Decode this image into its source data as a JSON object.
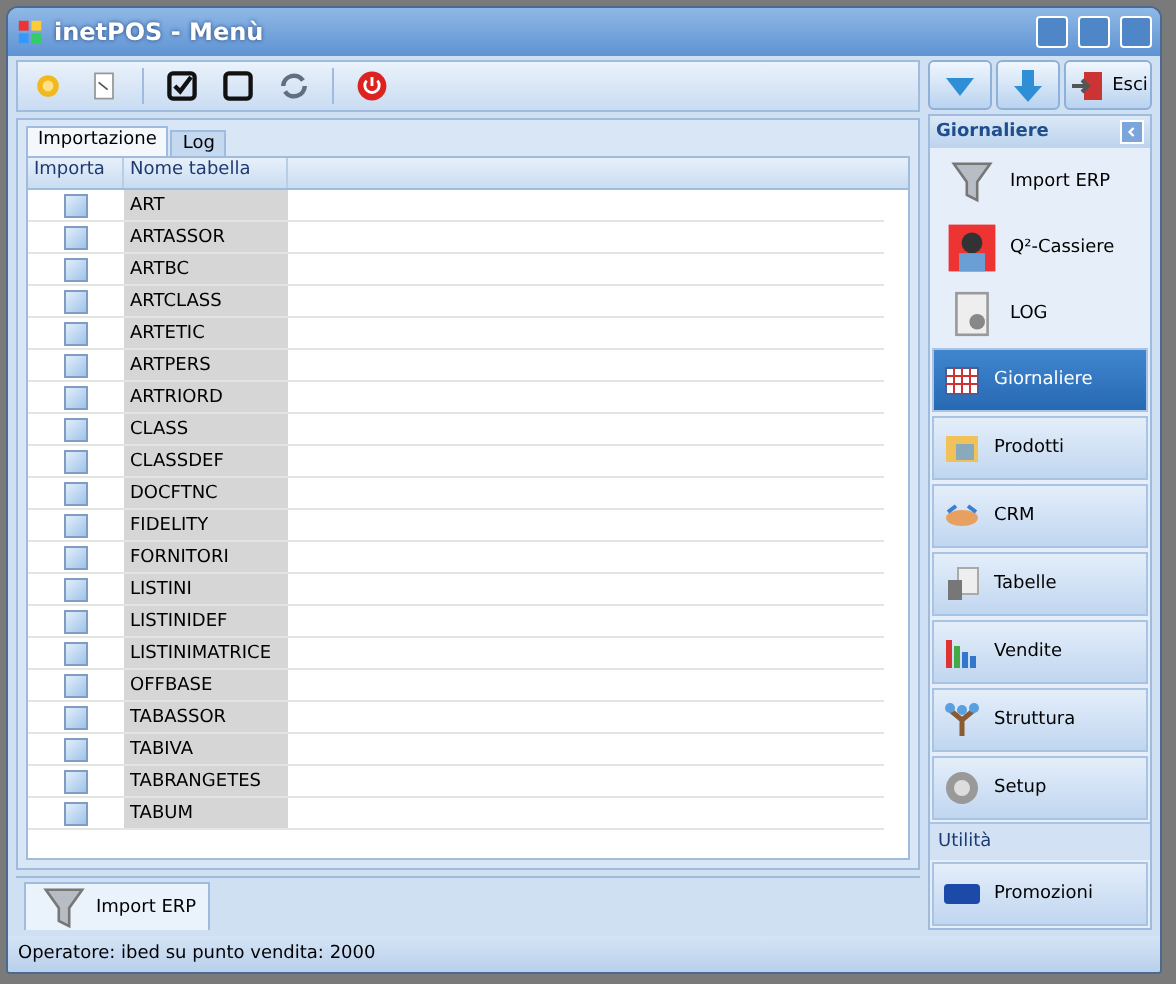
{
  "window": {
    "title": "inetPOS - Menù"
  },
  "toolbar": {
    "buttons": [
      {
        "kind": "sun"
      },
      {
        "kind": "paper"
      },
      {
        "kind": "check-all"
      },
      {
        "kind": "uncheck-all"
      },
      {
        "kind": "refresh"
      },
      {
        "kind": "power"
      }
    ]
  },
  "tabs": [
    {
      "label": "Importazione",
      "selected": true
    },
    {
      "label": "Log",
      "selected": false
    }
  ],
  "table": {
    "columns": [
      "Importa",
      "Nome tabella"
    ],
    "rows": [
      {
        "checked": false,
        "name": "ART"
      },
      {
        "checked": false,
        "name": "ARTASSOR"
      },
      {
        "checked": false,
        "name": "ARTBC"
      },
      {
        "checked": false,
        "name": "ARTCLASS"
      },
      {
        "checked": false,
        "name": "ARTETIC"
      },
      {
        "checked": false,
        "name": "ARTPERS"
      },
      {
        "checked": false,
        "name": "ARTRIORD"
      },
      {
        "checked": false,
        "name": "CLASS"
      },
      {
        "checked": false,
        "name": "CLASSDEF"
      },
      {
        "checked": false,
        "name": "DOCFTNC"
      },
      {
        "checked": false,
        "name": "FIDELITY"
      },
      {
        "checked": false,
        "name": "FORNITORI"
      },
      {
        "checked": false,
        "name": "LISTINI"
      },
      {
        "checked": false,
        "name": "LISTINIDEF"
      },
      {
        "checked": false,
        "name": "LISTINIMATRICE"
      },
      {
        "checked": false,
        "name": "OFFBASE"
      },
      {
        "checked": false,
        "name": "TABASSOR"
      },
      {
        "checked": false,
        "name": "TABIVA"
      },
      {
        "checked": false,
        "name": "TABRANGETES"
      },
      {
        "checked": false,
        "name": "TABUM"
      }
    ]
  },
  "bottom_tabs": [
    {
      "label": "Import ERP",
      "selected": true
    }
  ],
  "status_bar": "Operatore: ibed su punto vendita: 2000",
  "sidebar": {
    "top_buttons": [
      {
        "kind": "down"
      },
      {
        "kind": "arrow"
      },
      {
        "kind": "exit",
        "label": "Esci"
      }
    ],
    "group": {
      "title": "Giornaliere",
      "expanded": true,
      "items": [
        {
          "label": "Import ERP",
          "kind": "funnel"
        },
        {
          "label": "Q²-Cassiere",
          "kind": "person"
        },
        {
          "label": "LOG",
          "kind": "log"
        }
      ]
    },
    "nav": [
      {
        "label": "Giornaliere",
        "kind": "calendar",
        "selected": true
      },
      {
        "label": "Prodotti",
        "kind": "products",
        "selected": false
      },
      {
        "label": "CRM",
        "kind": "handshake",
        "selected": false
      },
      {
        "label": "Tabelle",
        "kind": "tables",
        "selected": false
      },
      {
        "label": "Vendite",
        "kind": "chart",
        "selected": false
      },
      {
        "label": "Struttura",
        "kind": "tree",
        "selected": false
      },
      {
        "label": "Setup",
        "kind": "gear",
        "selected": false
      }
    ],
    "section": {
      "title": "Utilità"
    },
    "bottom": [
      {
        "label": "Promozioni",
        "kind": "promo"
      }
    ]
  }
}
